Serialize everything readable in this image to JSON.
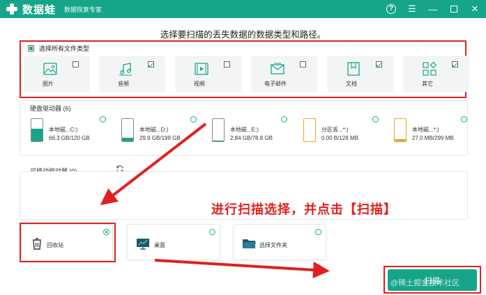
{
  "app": {
    "brand": "数据蛙",
    "subtitle": "数据恢复专家"
  },
  "headline": "选择要扫描的丢失数据的数据类型和路径。",
  "file_types": {
    "select_all_label": "选择所有文件类型",
    "items": [
      {
        "label": "图片",
        "icon": "image-icon",
        "checked": false
      },
      {
        "label": "音频",
        "icon": "music-icon",
        "checked": true
      },
      {
        "label": "视频",
        "icon": "video-icon",
        "checked": false
      },
      {
        "label": "电子邮件",
        "icon": "email-icon",
        "checked": false
      },
      {
        "label": "文档",
        "icon": "document-icon",
        "checked": true
      },
      {
        "label": "其它",
        "icon": "other-icon",
        "checked": true
      }
    ]
  },
  "hard_drives": {
    "title": "硬盘驱动器 (6)",
    "items": [
      {
        "name": "本地磁...C:)",
        "size": "66.3 GB/120 GB",
        "fill": 0.55,
        "color": "#17a589"
      },
      {
        "name": "本地磁...D:)",
        "size": "29.9 GB/199 GB",
        "fill": 0.15,
        "color": "#17a589"
      },
      {
        "name": "本地磁...E:)",
        "size": "2.84 GB/78.8 GB",
        "fill": 0.04,
        "color": "#17a589"
      },
      {
        "name": "分区丢...*:)",
        "size": "0.00  B/128 MB",
        "fill": 0.0,
        "color": "#f0a030"
      },
      {
        "name": "本地磁...*:)",
        "size": "27.0 MB/299 MB",
        "fill": 0.09,
        "color": "#f0a030"
      }
    ]
  },
  "removable": {
    "title": "可移动驱动器 (0)"
  },
  "locations": [
    {
      "label": "回收站",
      "icon": "recycle-bin-icon",
      "selected": true
    },
    {
      "label": "桌面",
      "icon": "desktop-icon",
      "selected": false
    },
    {
      "label": "选择文件夹",
      "icon": "folder-icon",
      "selected": false
    }
  ],
  "scan_button": "扫描",
  "annotation": "进行扫描选择，并点击【扫描】",
  "watermark": "@稀土掘金技术社区",
  "colors": {
    "accent": "#17a589",
    "annotation": "#e02020"
  }
}
